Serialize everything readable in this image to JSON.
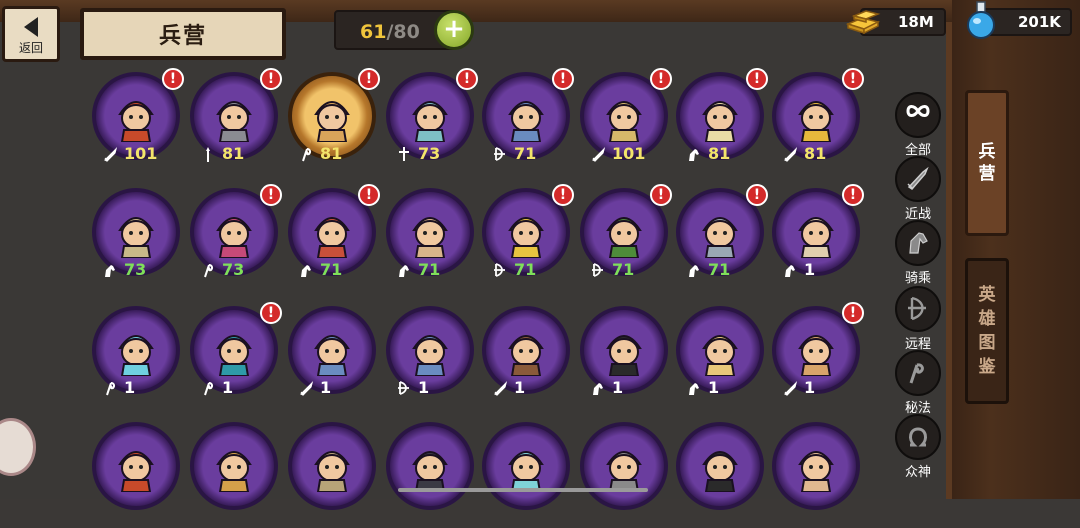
{
  "header": {
    "back_label": "返回",
    "title": "兵营",
    "capacity_current": "61",
    "capacity_sep": "/",
    "capacity_max": "80",
    "add_symbol": "+"
  },
  "resources": {
    "gold": "18M",
    "potion": "201K"
  },
  "units": [
    [
      {
        "class": "melee",
        "level": "101",
        "level_color": "#f3e46a",
        "alert": true,
        "hero": false,
        "tint": "#c84a2a"
      },
      {
        "class": "spear",
        "level": "81",
        "level_color": "#f3e46a",
        "alert": true,
        "hero": false,
        "tint": "#8a8c92"
      },
      {
        "class": "magic",
        "level": "81",
        "level_color": "#f3e46a",
        "alert": true,
        "hero": true,
        "tint": "#d9a45a"
      },
      {
        "class": "holy",
        "level": "73",
        "level_color": "#f3e46a",
        "alert": true,
        "hero": false,
        "tint": "#7ec0c4"
      },
      {
        "class": "ranged",
        "level": "71",
        "level_color": "#f3e46a",
        "alert": true,
        "hero": false,
        "tint": "#6a8bbf"
      },
      {
        "class": "melee",
        "level": "101",
        "level_color": "#f3e46a",
        "alert": true,
        "hero": false,
        "tint": "#d5b86a"
      },
      {
        "class": "cavalry",
        "level": "81",
        "level_color": "#f3e46a",
        "alert": true,
        "hero": false,
        "tint": "#e8dca6"
      },
      {
        "class": "melee",
        "level": "81",
        "level_color": "#f3e46a",
        "alert": true,
        "hero": false,
        "tint": "#e6b83c"
      }
    ],
    [
      {
        "class": "cavalry",
        "level": "73",
        "level_color": "#7fe05a",
        "alert": false,
        "hero": false,
        "tint": "#c8b888"
      },
      {
        "class": "magic",
        "level": "73",
        "level_color": "#7fe05a",
        "alert": true,
        "hero": false,
        "tint": "#c64a78"
      },
      {
        "class": "cavalry",
        "level": "71",
        "level_color": "#7fe05a",
        "alert": true,
        "hero": false,
        "tint": "#c8503a"
      },
      {
        "class": "cavalry",
        "level": "71",
        "level_color": "#7fe05a",
        "alert": false,
        "hero": false,
        "tint": "#d8b48a"
      },
      {
        "class": "ranged",
        "level": "71",
        "level_color": "#7fe05a",
        "alert": true,
        "hero": false,
        "tint": "#e8c440"
      },
      {
        "class": "ranged",
        "level": "71",
        "level_color": "#7fe05a",
        "alert": true,
        "hero": false,
        "tint": "#4e8c3a"
      },
      {
        "class": "cavalry",
        "level": "71",
        "level_color": "#7fe05a",
        "alert": true,
        "hero": false,
        "tint": "#9aa8b4"
      },
      {
        "class": "cavalry",
        "level": "1",
        "level_color": "#ffffff",
        "alert": true,
        "hero": false,
        "tint": "#e0cfae"
      }
    ],
    [
      {
        "class": "magic",
        "level": "1",
        "level_color": "#ffffff",
        "alert": false,
        "hero": false,
        "tint": "#6fd0e0"
      },
      {
        "class": "magic",
        "level": "1",
        "level_color": "#ffffff",
        "alert": true,
        "hero": false,
        "tint": "#2e9aa8"
      },
      {
        "class": "melee",
        "level": "1",
        "level_color": "#ffffff",
        "alert": false,
        "hero": false,
        "tint": "#6a8cc0"
      },
      {
        "class": "ranged",
        "level": "1",
        "level_color": "#ffffff",
        "alert": false,
        "hero": false,
        "tint": "#6a8cc0"
      },
      {
        "class": "melee",
        "level": "1",
        "level_color": "#ffffff",
        "alert": false,
        "hero": false,
        "tint": "#8a5a3a"
      },
      {
        "class": "cavalry",
        "level": "1",
        "level_color": "#ffffff",
        "alert": false,
        "hero": false,
        "tint": "#2a2a2a"
      },
      {
        "class": "cavalry",
        "level": "1",
        "level_color": "#ffffff",
        "alert": false,
        "hero": false,
        "tint": "#e8c87a"
      },
      {
        "class": "melee",
        "level": "1",
        "level_color": "#ffffff",
        "alert": true,
        "hero": false,
        "tint": "#d8a46a"
      }
    ],
    [
      {
        "class": "melee",
        "level": "",
        "level_color": "#ffffff",
        "alert": false,
        "hero": false,
        "tint": "#c84a2a"
      },
      {
        "class": "cavalry",
        "level": "",
        "level_color": "#ffffff",
        "alert": false,
        "hero": false,
        "tint": "#d4a04a"
      },
      {
        "class": "melee",
        "level": "",
        "level_color": "#ffffff",
        "alert": false,
        "hero": false,
        "tint": "#b8a478"
      },
      {
        "class": "magic",
        "level": "",
        "level_color": "#ffffff",
        "alert": false,
        "hero": false,
        "tint": "#3a3a44"
      },
      {
        "class": "magic",
        "level": "",
        "level_color": "#ffffff",
        "alert": false,
        "hero": false,
        "tint": "#7fd2d8"
      },
      {
        "class": "melee",
        "level": "",
        "level_color": "#ffffff",
        "alert": false,
        "hero": false,
        "tint": "#8a8a8a"
      },
      {
        "class": "ranged",
        "level": "",
        "level_color": "#ffffff",
        "alert": false,
        "hero": false,
        "tint": "#2a2a2a"
      },
      {
        "class": "melee",
        "level": "",
        "level_color": "#ffffff",
        "alert": false,
        "hero": false,
        "tint": "#e0b890"
      }
    ]
  ],
  "filters": [
    {
      "key": "all",
      "label": "全部",
      "icon": "infinity-icon"
    },
    {
      "key": "melee",
      "label": "近战",
      "icon": "sword-icon"
    },
    {
      "key": "cavalry",
      "label": "骑乘",
      "icon": "horse-icon"
    },
    {
      "key": "ranged",
      "label": "远程",
      "icon": "bow-icon"
    },
    {
      "key": "magic",
      "label": "秘法",
      "icon": "staff-icon"
    },
    {
      "key": "holy",
      "label": "众神",
      "icon": "omega-icon"
    }
  ],
  "tabs": {
    "barracks": [
      "兵",
      "营"
    ],
    "codex": [
      "英",
      "雄",
      "图",
      "鉴"
    ]
  },
  "alert_symbol": "!",
  "colors": {
    "accent_gold": "#f0c53c",
    "alert_red": "#d42a2a",
    "add_green": "#86a829",
    "ring_purple": "#6a3d9e"
  }
}
